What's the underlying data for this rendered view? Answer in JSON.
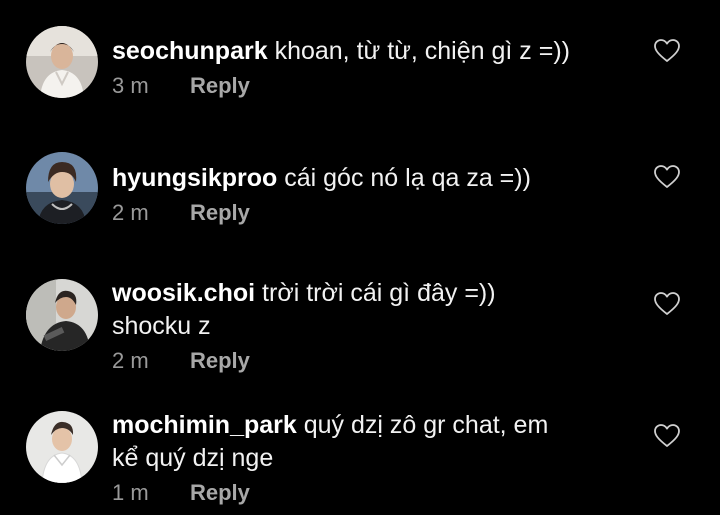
{
  "comments": [
    {
      "username": "seochunpark",
      "text": "khoan, từ từ, chiện gì z =))",
      "time": "3 m",
      "reply_label": "Reply",
      "like_icon": "heart-outline-icon"
    },
    {
      "username": "hyungsikproo",
      "text": "cái góc nó lạ qa za =))",
      "time": "2 m",
      "reply_label": "Reply",
      "like_icon": "heart-outline-icon"
    },
    {
      "username": "woosik.choi",
      "text": "trời trời cái gì đây =))\nshocku z",
      "time": "2 m",
      "reply_label": "Reply",
      "like_icon": "heart-outline-icon"
    },
    {
      "username": "mochimin_park",
      "text": "quý dzị zô gr chat, em\nkể quý dzị nge",
      "time": "1 m",
      "reply_label": "Reply",
      "like_icon": "heart-outline-icon"
    }
  ],
  "colors": {
    "background": "#000000",
    "text": "#f2f2f2",
    "muted": "#9a9a9a",
    "icon": "#cfcfcf"
  }
}
